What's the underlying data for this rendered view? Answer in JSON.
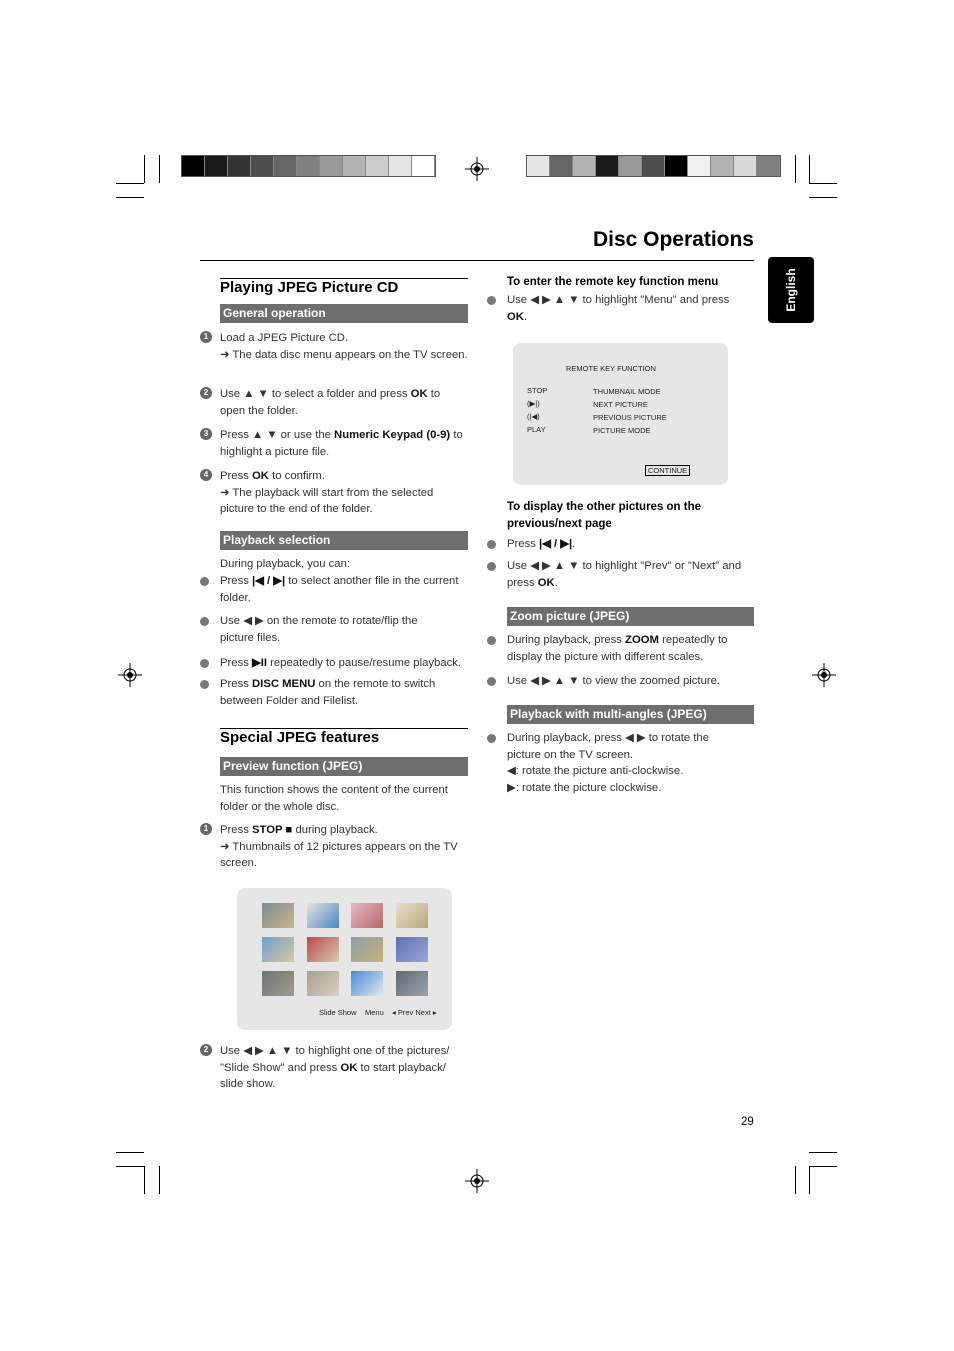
{
  "header": {
    "title": "Disc Operations",
    "lang_tab": "English",
    "page_number": "29"
  },
  "print_marks": {
    "left_bar": [
      "#000000",
      "#1a1a1a",
      "#333333",
      "#4d4d4d",
      "#666666",
      "#808080",
      "#999999",
      "#b3b3b3",
      "#cccccc",
      "#e6e6e6",
      "#ffffff"
    ],
    "right_bar": [
      "#e6e6e6",
      "#666666",
      "#b3b3b3",
      "#1a1a1a",
      "#999999",
      "#4d4d4d",
      "#000000",
      "#f2f2f2",
      "#b3b3b3",
      "#d9d9d9",
      "#808080"
    ]
  },
  "left": {
    "section1_title": "Playing JPEG Picture CD",
    "general_bar": "General operation",
    "g_steps": [
      {
        "n": "1",
        "text": [
          "Load a JPEG Picture CD."
        ],
        "note": "➜  The data disc menu appears on the TV screen."
      },
      {
        "n": "2",
        "text": [
          "Use ▲ ▼  to select a folder and press ",
          {
            "b": "OK"
          },
          " to open the folder."
        ]
      },
      {
        "n": "3",
        "text": [
          "Press ▲ ▼  or use the ",
          {
            "b": "Numeric Keypad (0-9)"
          },
          " to highlight a picture file."
        ]
      },
      {
        "n": "4",
        "text": [
          "Press ",
          {
            "b": "OK"
          },
          " to confirm."
        ],
        "note": "➜  The playback will start from the selected picture to the end of the folder."
      }
    ],
    "playback_bar": "Playback selection",
    "playback_intro": "During playback, you can:",
    "playback_items": [
      [
        "Press ",
        {
          "b": "|◀ / ▶|"
        },
        " to select another file in the current folder."
      ],
      [
        "Use ◀ ▶ on the remote to rotate/flip the picture files."
      ],
      [
        "Press ",
        {
          "b": "▶II"
        },
        " repeatedly to pause/resume playback."
      ],
      [
        "Press ",
        {
          "b": "DISC MENU"
        },
        " on the remote to switch between Folder and Filelist."
      ]
    ],
    "section2_title": "Special JPEG features",
    "preview_bar": "Preview function (JPEG)",
    "preview_intro": "This function shows the content of the current folder or the whole disc.",
    "p_step1": {
      "n": "1",
      "text": [
        "Press ",
        {
          "b": "STOP ■"
        },
        " during playback."
      ],
      "note": "➜  Thumbnails of 12 pictures appears on the TV screen."
    },
    "thumb_screen": {
      "slide_show": "Slide Show",
      "menu": "Menu",
      "prev_next": "◂ Prev Next ▸"
    },
    "p_step2": {
      "n": "2",
      "text": [
        "Use ◀ ▶ ▲ ▼ to highlight one of the pictures/ \"Slide Show\" and press ",
        {
          "b": "OK"
        },
        " to start playback/ slide show."
      ]
    }
  },
  "right": {
    "remote_heading": "To enter the remote key function menu",
    "remote_item": [
      "Use ◀ ▶ ▲ ▼ to highlight \"Menu\" and press ",
      {
        "b": "OK"
      },
      "."
    ],
    "remote_screen": {
      "title": "REMOTE KEY FUNCTION",
      "rows": [
        {
          "key": "STOP",
          "fn": "THUMBNAIL MODE"
        },
        {
          "key": "(▶|)",
          "fn": "NEXT PICTURE"
        },
        {
          "key": "(|◀)",
          "fn": "PREVIOUS PICTURE"
        },
        {
          "key": "PLAY",
          "fn": "PICTURE MODE"
        }
      ],
      "continue": "CONTINUE"
    },
    "other_heading": "To display the other pictures on the previous/next page",
    "other_items": [
      [
        "Press  ",
        {
          "b": "|◀ / ▶|"
        },
        "."
      ],
      [
        "Use ◀ ▶ ▲ ▼ to highlight \"Prev\" or \"Next\" and press ",
        {
          "b": "OK"
        },
        "."
      ]
    ],
    "zoom_bar": "Zoom picture (JPEG)",
    "zoom_items": [
      [
        "During playback, press ",
        {
          "b": "ZOOM"
        },
        " repeatedly to display the picture with different scales."
      ],
      [
        "Use ◀ ▶ ▲ ▼ to view the zoomed picture."
      ]
    ],
    "angles_bar": "Playback with multi-angles (JPEG)",
    "angles_item": [
      "During playback, press ◀ ▶  to rotate the picture on the TV screen."
    ],
    "angles_lines": [
      "◀: rotate the picture anti-clockwise.",
      "▶: rotate the picture clockwise."
    ]
  }
}
